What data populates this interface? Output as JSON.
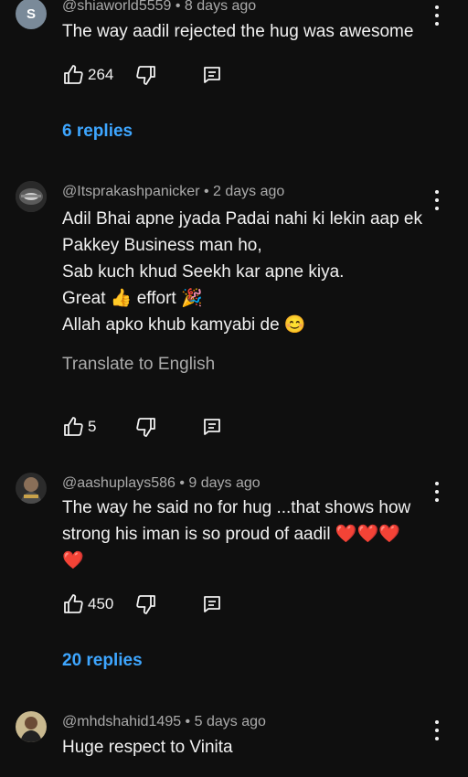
{
  "comments": [
    {
      "avatar_letter": "S",
      "author": "@shiaworld5559",
      "time": "8 days ago",
      "lines": [
        "The way aadil rejected the hug was awesome"
      ],
      "likes": "264",
      "replies": "6 replies"
    },
    {
      "author": "@Itsprakashpanicker",
      "time": "2 days ago",
      "lines": [
        "Adil Bhai apne jyada Padai nahi ki lekin aap ek",
        "Pakkey Business man ho,",
        "Sab kuch khud Seekh kar apne kiya.",
        "Great 👍 effort 🎉",
        "Allah apko khub kamyabi de 😊"
      ],
      "translate": "Translate to English",
      "likes": "5"
    },
    {
      "author": "@aashuplays586",
      "time": "9 days ago",
      "lines": [
        "The way he said no for hug  ...that shows how",
        "strong his iman is so proud of aadil ❤️❤️❤️",
        "❤️"
      ],
      "likes": "450",
      "replies": "20 replies"
    },
    {
      "author": "@mhdshahid1495",
      "time": "5 days ago",
      "lines": [
        "Huge respect to Vinita"
      ]
    }
  ],
  "colors": {
    "background": "#0f0f0f",
    "text": "#f1f1f1",
    "secondary": "#aaaaaa",
    "link": "#3ea6ff"
  }
}
